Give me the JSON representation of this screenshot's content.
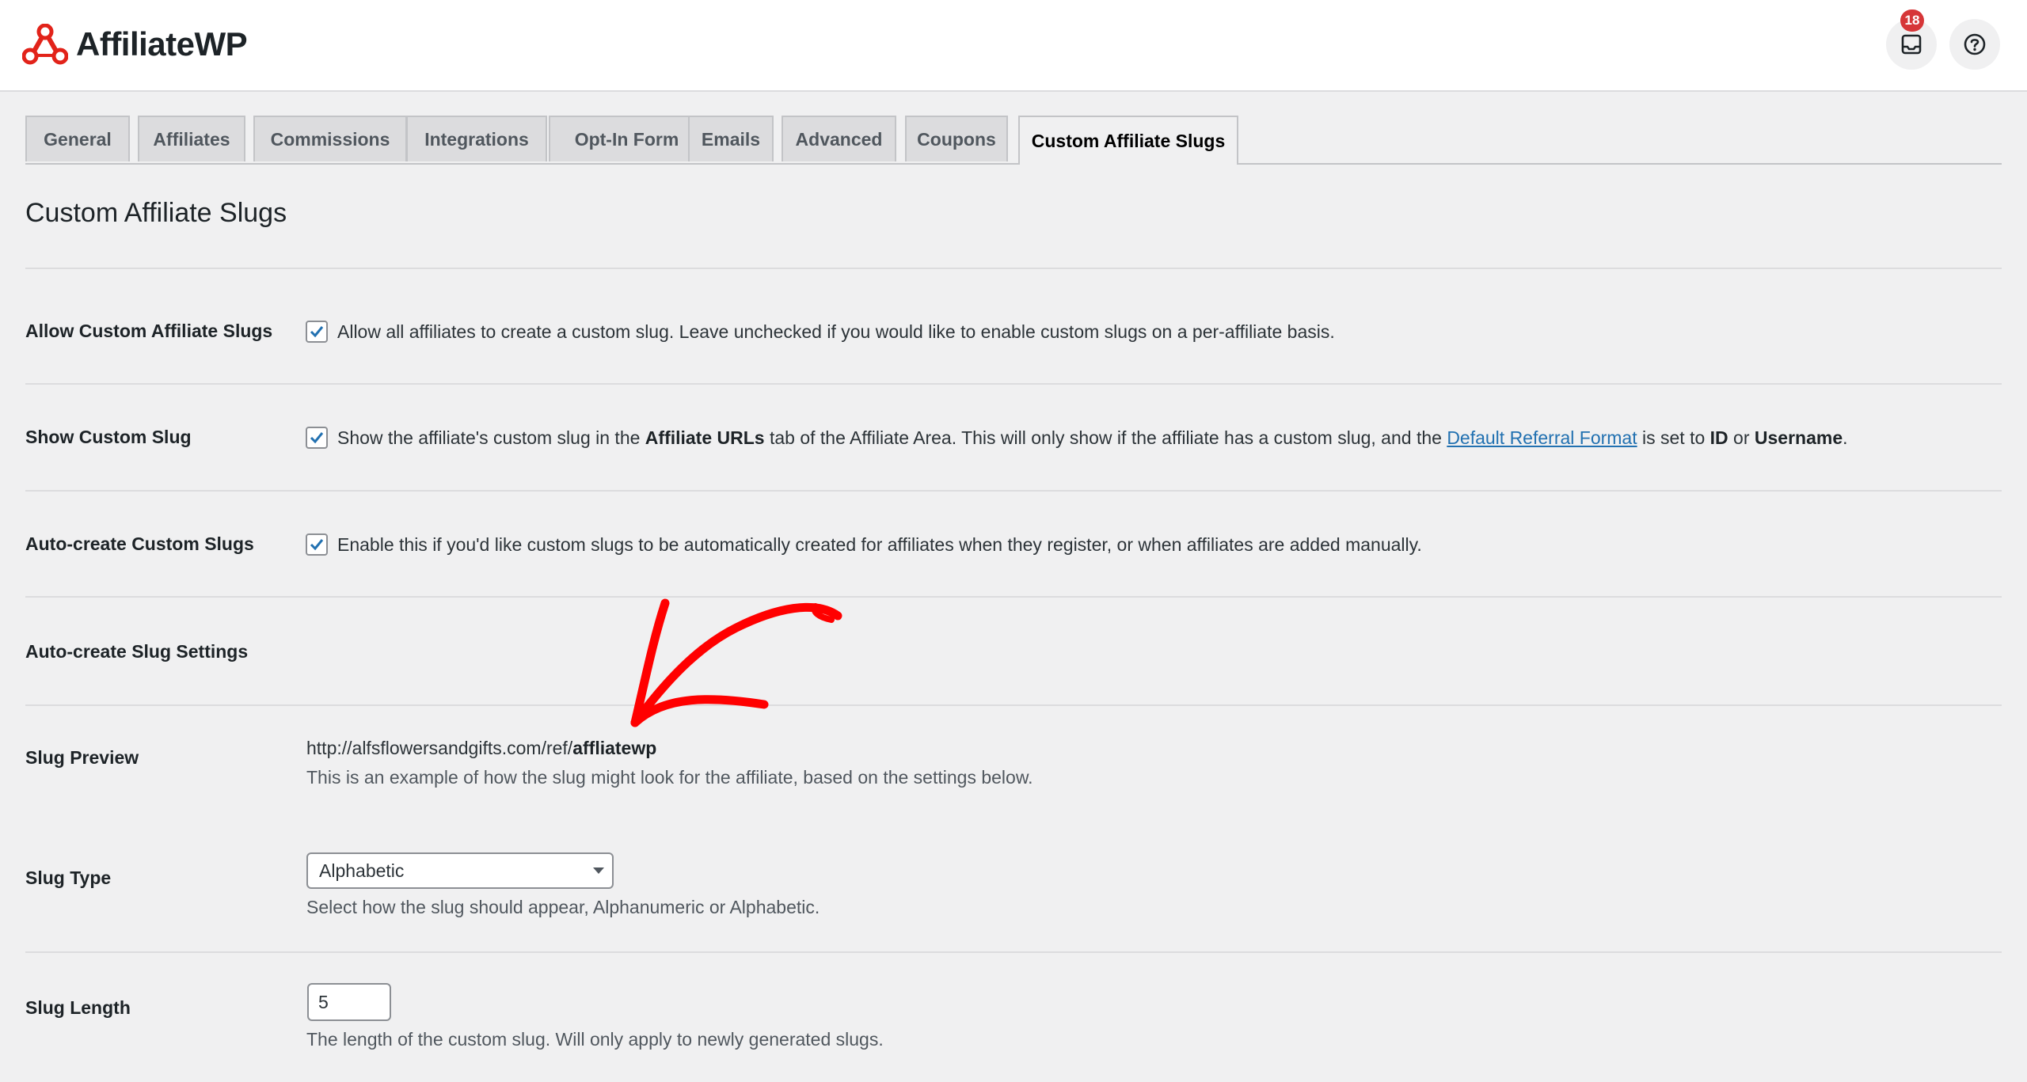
{
  "header": {
    "brand": "AffiliateWP",
    "notification_count": "18",
    "icons": [
      "affiliatewp-logo-icon",
      "inbox-icon",
      "help-icon"
    ]
  },
  "tabs": [
    {
      "label": "General",
      "active": false
    },
    {
      "label": "Affiliates",
      "active": false
    },
    {
      "label": "Commissions",
      "active": false
    },
    {
      "label": "Integrations",
      "active": false
    },
    {
      "label": "Opt-In Form",
      "active": false
    },
    {
      "label": "Emails",
      "active": false
    },
    {
      "label": "Advanced",
      "active": false
    },
    {
      "label": "Coupons",
      "active": false
    },
    {
      "label": "Custom Affiliate Slugs",
      "active": true
    }
  ],
  "page_title": "Custom Affiliate Slugs",
  "settings": {
    "allow": {
      "label": "Allow Custom Affiliate Slugs",
      "checked": true,
      "text": "Allow all affiliates to create a custom slug. Leave unchecked if you would like to enable custom slugs on a per-affiliate basis."
    },
    "show": {
      "label": "Show Custom Slug",
      "checked": true,
      "text_1": "Show the affiliate's custom slug in the ",
      "bold_1": "Affiliate URLs",
      "text_2": " tab of the Affiliate Area. This will only show if the affiliate has a custom slug, and the ",
      "link": "Default Referral Format",
      "text_3": " is set to ",
      "bold_2": "ID",
      "text_4": " or ",
      "bold_3": "Username",
      "text_5": "."
    },
    "auto_create": {
      "label": "Auto-create Custom Slugs",
      "checked": true,
      "text": "Enable this if you'd like custom slugs to be automatically created for affiliates when they register, or when affiliates are added manually."
    },
    "auto_settings": {
      "label": "Auto-create Slug Settings"
    },
    "slug_preview": {
      "label": "Slug Preview",
      "url_base": "http://alfsflowersandgifts.com/ref/",
      "url_slug": "affliatewp",
      "description": "This is an example of how the slug might look for the affiliate, based on the settings below."
    },
    "slug_type": {
      "label": "Slug Type",
      "selected": "Alphabetic",
      "description": "Select how the slug should appear, Alphanumeric or Alphabetic."
    },
    "slug_length": {
      "label": "Slug Length",
      "value": "5",
      "description": "The length of the custom slug. Will only apply to newly generated slugs."
    }
  },
  "colors": {
    "brand_red": "#e2231a",
    "link": "#2271b1",
    "checkbox_check": "#2271b1",
    "annotation_arrow": "#ff0000",
    "badge": "#d63638"
  }
}
